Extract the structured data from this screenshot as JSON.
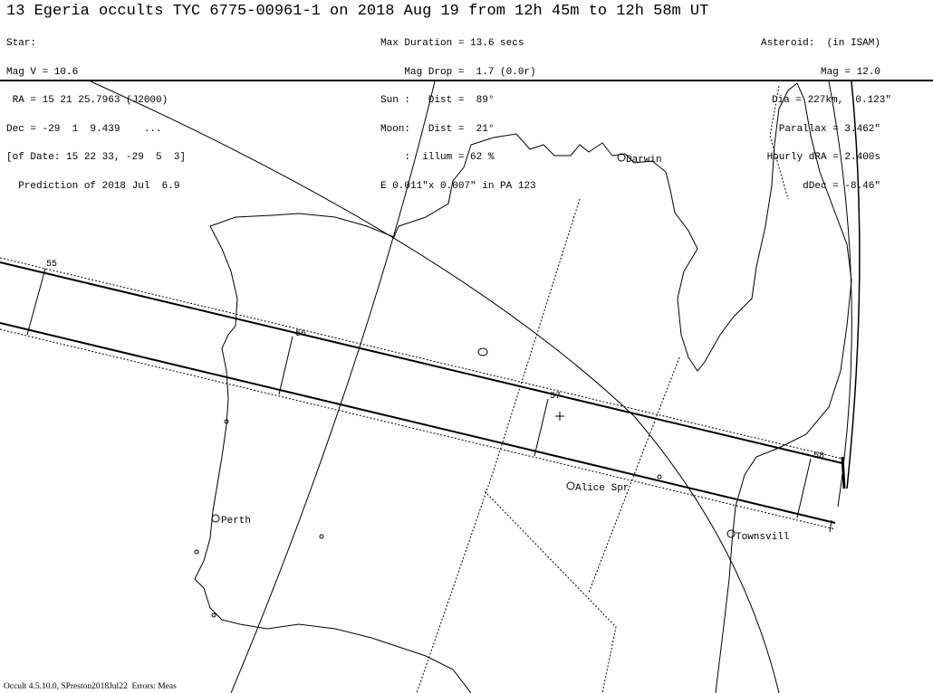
{
  "title": "13 Egeria occults TYC 6775-00961-1 on 2018 Aug 19 from 12h 45m to 12h 58m UT",
  "star_block": [
    "Star:",
    "Mag V = 10.6",
    " RA = 15 21 25.7963 (J2000)",
    "Dec = -29  1  9.439    ...",
    "[of Date: 15 22 33, -29  5  3]",
    "  Prediction of 2018 Jul  6.9"
  ],
  "event_block": [
    "Max Duration = 13.6 secs",
    "    Mag Drop =  1.7 (0.0r)",
    "Sun :   Dist =  89°",
    "Moon:   Dist =  21°",
    "    :  illum = 62 %",
    "E 0.011\"x 0.007\" in PA 123"
  ],
  "asteroid_block": [
    "Asteroid:  (in ISAM)",
    "Mag = 12.0",
    "Dia = 227km,  0.123\"",
    "Parallax = 3.462\"",
    "Hourly dRA = 2.400s",
    "dDec = -8.46\""
  ],
  "time_ticks": [
    "55",
    "56",
    "57",
    "58"
  ],
  "cities": [
    "Darwin",
    "Alice Spr",
    "Perth",
    "Townsvill"
  ],
  "footer": "Occult 4.5.10.0, SPreston2018Jul22  Errors: Meas"
}
